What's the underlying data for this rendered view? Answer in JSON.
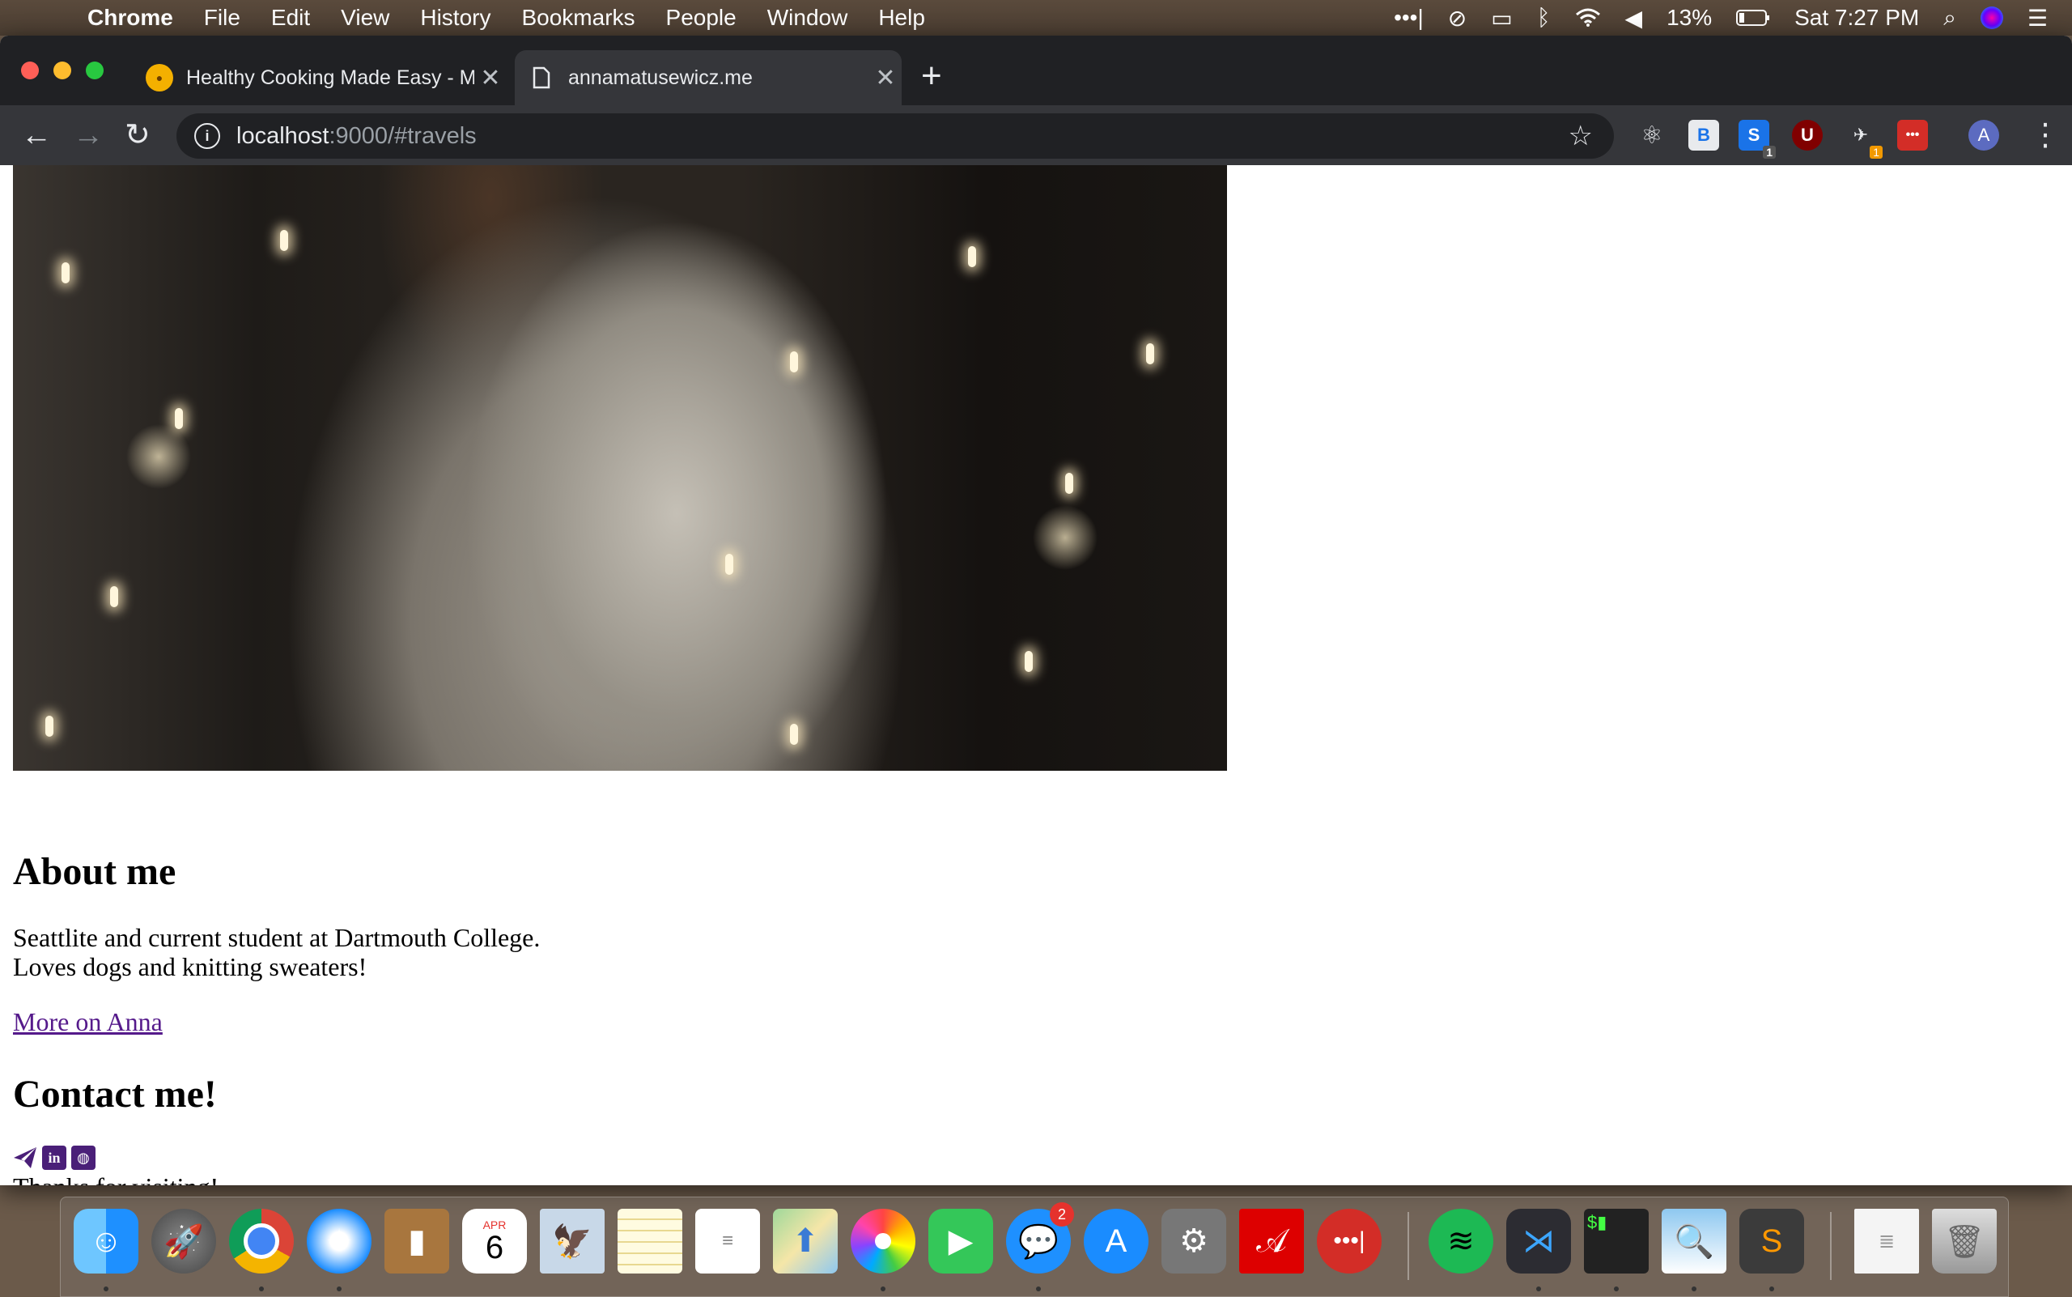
{
  "menubar": {
    "app_name": "Chrome",
    "items": [
      "File",
      "Edit",
      "View",
      "History",
      "Bookmarks",
      "People",
      "Window",
      "Help"
    ],
    "battery": "13%",
    "clock": "Sat 7:27 PM"
  },
  "tabs": [
    {
      "title": "Healthy Cooking Made Easy - M",
      "active": false
    },
    {
      "title": "annamatusewicz.me",
      "active": true
    }
  ],
  "omnibox": {
    "host": "localhost",
    "path": ":9000/#travels"
  },
  "extensions": [
    {
      "name": "react-devtools",
      "label": "⚛"
    },
    {
      "name": "b-extension",
      "label": "B"
    },
    {
      "name": "s-extension",
      "label": "S",
      "badge": "1"
    },
    {
      "name": "ublock",
      "label": "U"
    },
    {
      "name": "duck-extension",
      "label": "✈",
      "badge": "1"
    },
    {
      "name": "lastpass",
      "label": "•••"
    },
    {
      "name": "profile-avatar",
      "label": "A"
    }
  ],
  "page": {
    "about_heading": "About me",
    "bio_line1": "Seattlite and current student at Dartmouth College.",
    "bio_line2": "Loves dogs and knitting sweaters!",
    "more_link": "More on Anna",
    "contact_heading": "Contact me!",
    "thanks": "Thanks for visiting!"
  },
  "dock": {
    "calendar_month": "APR",
    "calendar_day": "6",
    "messages_badge": "2"
  },
  "colors": {
    "link": "#551a8b",
    "icon_purple": "#4a1f78",
    "chrome_dark": "#202124",
    "chrome_toolbar": "#35363a"
  }
}
